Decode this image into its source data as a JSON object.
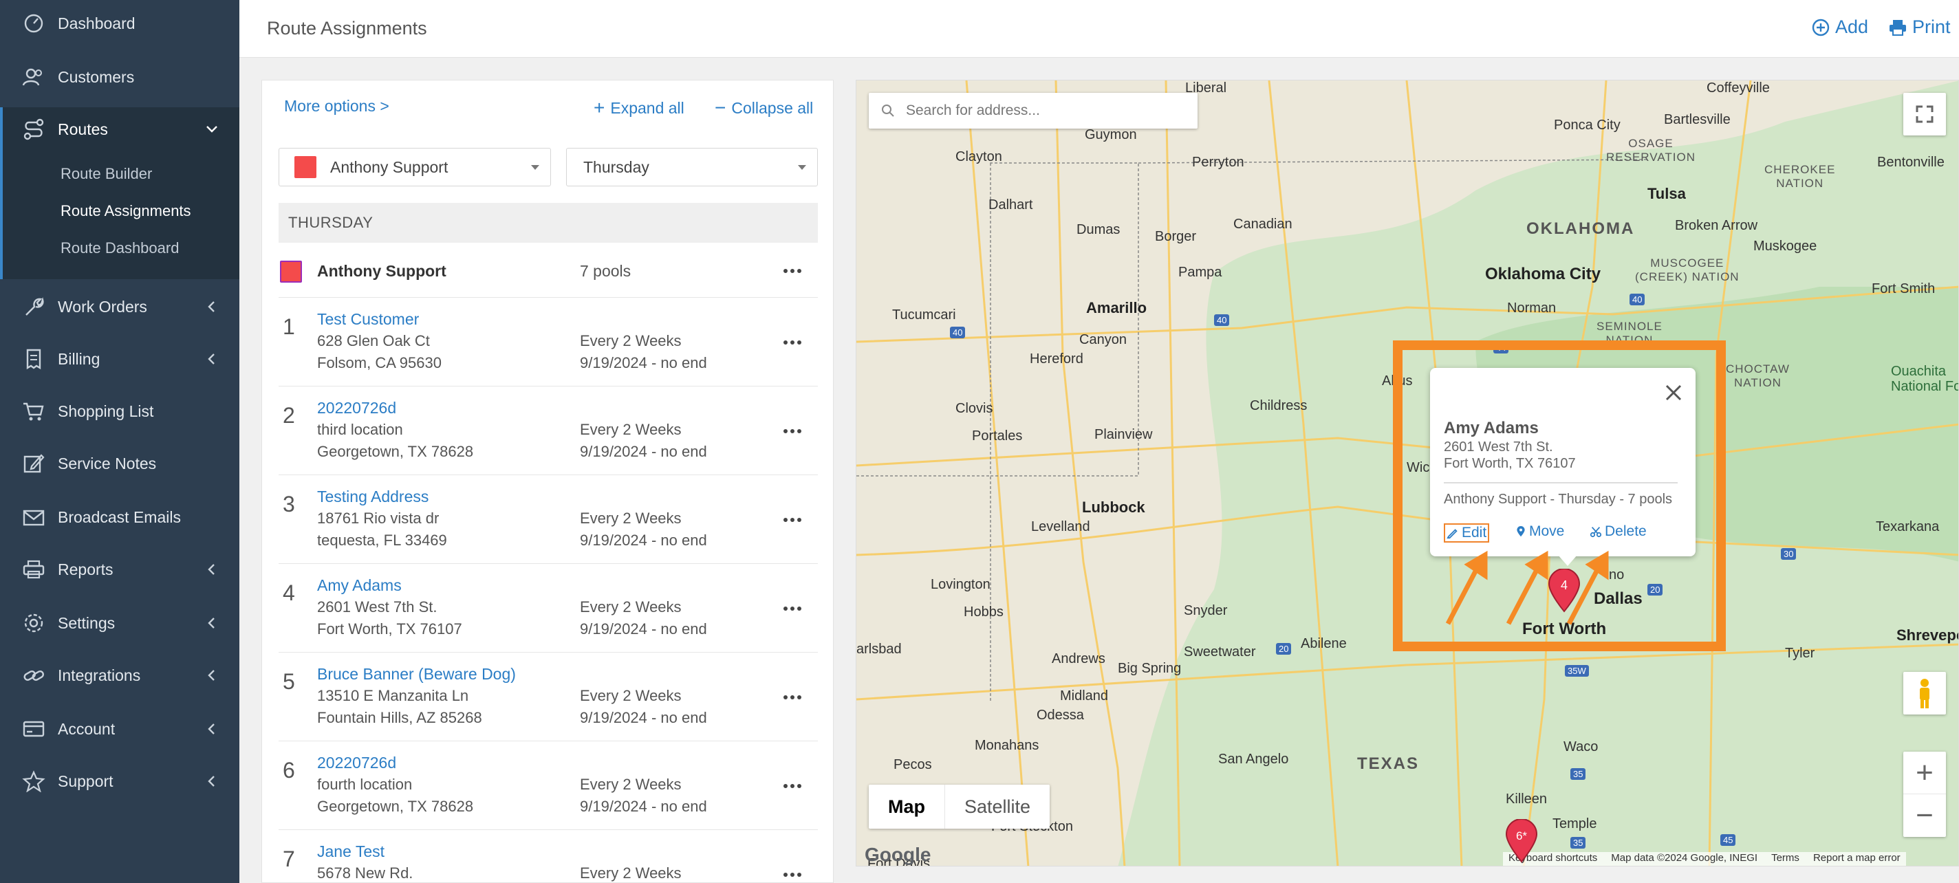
{
  "sidebar": {
    "items": [
      {
        "label": "Dashboard"
      },
      {
        "label": "Customers"
      },
      {
        "label": "Routes"
      },
      {
        "label": "Work Orders"
      },
      {
        "label": "Billing"
      },
      {
        "label": "Shopping List"
      },
      {
        "label": "Service Notes"
      },
      {
        "label": "Broadcast Emails"
      },
      {
        "label": "Reports"
      },
      {
        "label": "Settings"
      },
      {
        "label": "Integrations"
      },
      {
        "label": "Account"
      },
      {
        "label": "Support"
      }
    ],
    "routes_sub": [
      {
        "label": "Route Builder"
      },
      {
        "label": "Route Assignments"
      },
      {
        "label": "Route Dashboard"
      }
    ]
  },
  "header": {
    "title": "Route Assignments",
    "add_label": "Add",
    "print_label": "Print"
  },
  "panel": {
    "more_options": "More options >",
    "expand_all": "Expand all",
    "collapse_all": "Collapse all",
    "tech_select": "Anthony Support",
    "day_select": "Thursday",
    "day_header": "THURSDAY",
    "tech_name": "Anthony Support",
    "tech_pools": "7 pools",
    "accent_color": "#f44b4b",
    "stops": [
      {
        "num": "1",
        "name": "Test Customer",
        "addr1": "628 Glen Oak Ct",
        "addr2": "Folsom, CA 95630",
        "freq": "Every 2 Weeks",
        "dates": "9/19/2024 - no end"
      },
      {
        "num": "2",
        "name": "20220726d",
        "addr1": "third location",
        "addr2": "Georgetown, TX 78628",
        "freq": "Every 2 Weeks",
        "dates": "9/19/2024 - no end"
      },
      {
        "num": "3",
        "name": "Testing Address",
        "addr1": "18761 Rio vista dr",
        "addr2": "tequesta, FL 33469",
        "freq": "Every 2 Weeks",
        "dates": "9/19/2024 - no end"
      },
      {
        "num": "4",
        "name": "Amy Adams",
        "addr1": "2601 West 7th St.",
        "addr2": "Fort Worth, TX 76107",
        "freq": "Every 2 Weeks",
        "dates": "9/19/2024 - no end"
      },
      {
        "num": "5",
        "name": "Bruce Banner (Beware Dog)",
        "addr1": "13510 E Manzanita Ln",
        "addr2": "Fountain Hills, AZ 85268",
        "freq": "Every 2 Weeks",
        "dates": "9/19/2024 - no end"
      },
      {
        "num": "6",
        "name": "20220726d",
        "addr1": "fourth location",
        "addr2": "Georgetown, TX 78628",
        "freq": "Every 2 Weeks",
        "dates": "9/19/2024 - no end"
      },
      {
        "num": "7",
        "name": "Jane Test",
        "addr1": "5678 New Rd.",
        "addr2": "",
        "freq": "Every 2 Weeks",
        "dates": ""
      }
    ]
  },
  "map": {
    "search_placeholder": "Search for address...",
    "map_btn": "Map",
    "satellite_btn": "Satellite",
    "google": "Google",
    "attrib": {
      "shortcuts": "Keyboard shortcuts",
      "data": "Map data ©2024 Google, INEGI",
      "terms": "Terms",
      "report": "Report a map error"
    },
    "labels": {
      "liberal": "Liberal",
      "guymon": "Guymon",
      "clayton": "Clayton",
      "perryton": "Perryton",
      "dalhart": "Dalhart",
      "dumas": "Dumas",
      "borger": "Borger",
      "canadian": "Canadian",
      "pampa": "Pampa",
      "amarillo": "Amarillo",
      "canyon": "Canyon",
      "tucumcari": "Tucumcari",
      "hereford": "Hereford",
      "clovis": "Clovis",
      "portales": "Portales",
      "childress": "Childress",
      "plainview": "Plainview",
      "altus": "Altus",
      "lubbock": "Lubbock",
      "levelland": "Levelland",
      "lovington": "Lovington",
      "hobbs": "Hobbs",
      "snyder": "Snyder",
      "carlsbad": "arlsbad",
      "andrews": "Andrews",
      "sweetwater": "Sweetwater",
      "abilene": "Abilene",
      "bigspring": "Big Spring",
      "midland": "Midland",
      "odessa": "Odessa",
      "monahans": "Monahans",
      "pecos": "Pecos",
      "fortstockton": "Fort Stockton",
      "fortdavis": "Fort Davis",
      "sanangelo": "San Angelo",
      "texas": "TEXAS",
      "waco": "Waco",
      "killeen": "Killeen",
      "temple": "Temple",
      "oklahoma": "OKLAHOMA",
      "okcity": "Oklahoma City",
      "norman": "Norman",
      "tulsa": "Tulsa",
      "poncacity": "Ponca City",
      "bartlesville": "Bartlesville",
      "coffeyville": "Coffeyville",
      "bentonville": "Bentonville",
      "osage": "OSAGE\nRESERVATION",
      "cherokee": "CHEROKEE\nNATION",
      "brokenarrow": "Broken Arrow",
      "muskogee": "Muskogee",
      "muscogee": "MUSCOGEE\n(CREEK) NATION",
      "fortsmith": "Fort Smith",
      "seminole": "SEMINOLE\nNATION",
      "choctaw": "CHOCTAW\nNATION",
      "ouachita": "Ouachita\nNational Fo",
      "texarkana": "Texarkana",
      "tyler": "Tyler",
      "shreveport": "Shrevepor",
      "dallas": "Dallas",
      "fortworth": "Fort Worth",
      "wic": "Wic",
      "hano": "no"
    },
    "highways": [
      "40",
      "40",
      "40",
      "35W",
      "35",
      "35",
      "20",
      "20",
      "30",
      "44",
      "45"
    ]
  },
  "popup": {
    "name": "Amy Adams",
    "addr1": "2601 West 7th St.",
    "addr2": "Fort Worth, TX  76107",
    "info": "Anthony Support - Thursday - 7 pools",
    "edit": "Edit",
    "move": "Move",
    "delete": "Delete"
  },
  "markers": {
    "amy": "4",
    "sixth": "6*"
  },
  "colors": {
    "sidebar_bg": "#2d3e50",
    "link": "#2b7dc5",
    "highlight": "#f58a25",
    "marker": "#e8364f"
  }
}
